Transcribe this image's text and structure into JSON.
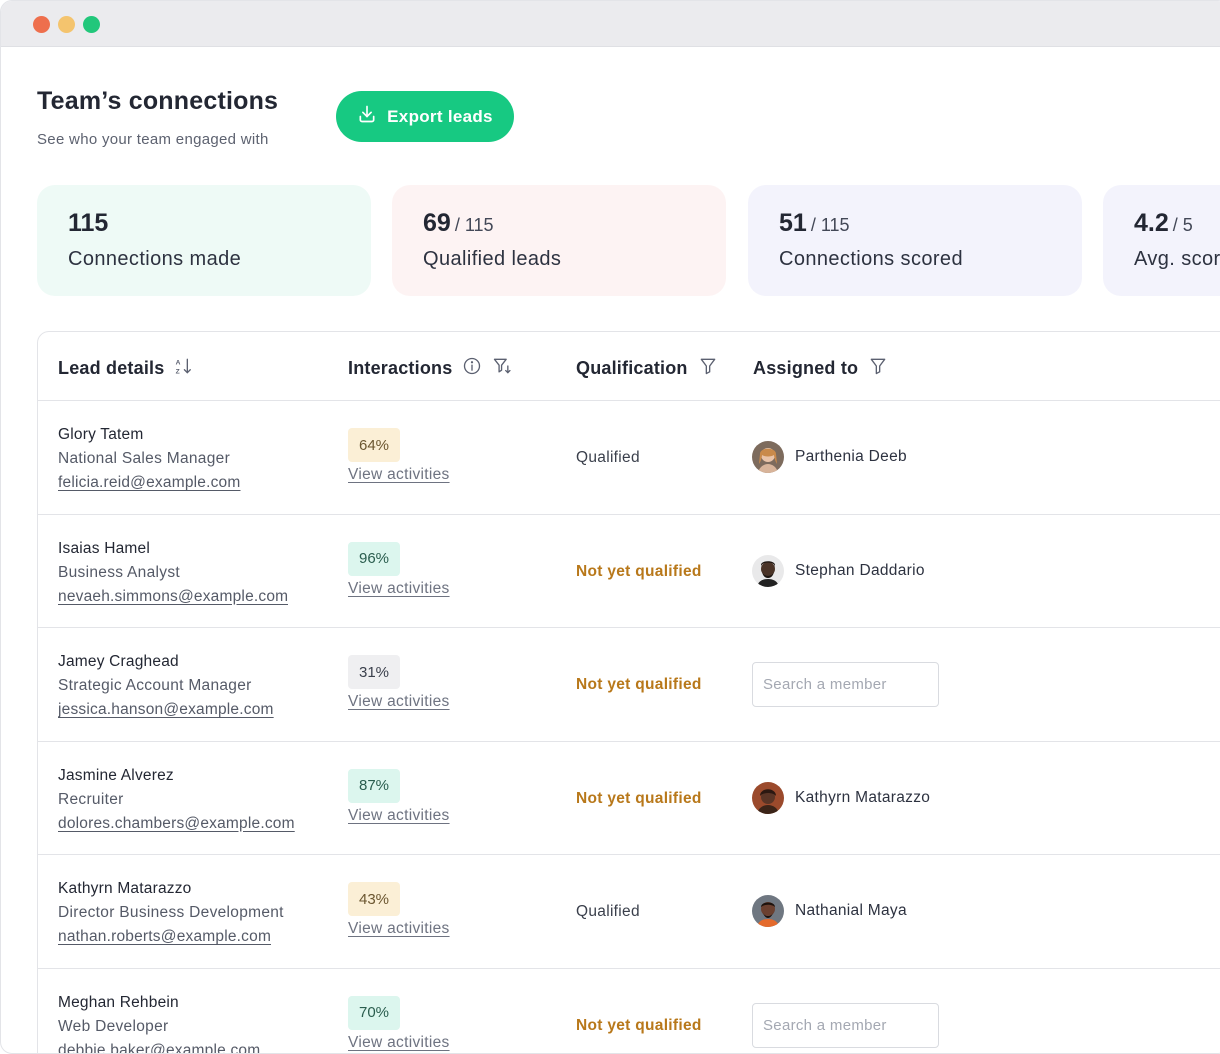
{
  "page": {
    "title": "Team’s connections",
    "subtitle": "See who your team engaged with",
    "export_label": "Export leads"
  },
  "stats": [
    {
      "value": "115",
      "total": "",
      "label": "Connections made"
    },
    {
      "value": "69",
      "total": "/ 115",
      "label": "Qualified leads"
    },
    {
      "value": "51",
      "total": "/ 115",
      "label": "Connections scored"
    },
    {
      "value": "4.2",
      "total": "/ 5",
      "label": "Avg. score"
    }
  ],
  "table": {
    "headers": {
      "lead": "Lead details",
      "interactions": "Interactions",
      "qualification": "Qualification",
      "assigned": "Assigned to"
    },
    "view_label": "View activities",
    "search_placeholder": "Search a member",
    "rows": [
      {
        "name": "Glory Tatem",
        "role": "National Sales Manager",
        "email": "felicia.reid@example.com",
        "interaction": "64%",
        "qualification": "Qualified",
        "assignee": "Parthenia Deeb"
      },
      {
        "name": "Isaias Hamel",
        "role": "Business Analyst",
        "email": "nevaeh.simmons@example.com",
        "interaction": "96%",
        "qualification": "Not yet qualified",
        "assignee": "Stephan Daddario"
      },
      {
        "name": "Jamey Craghead",
        "role": "Strategic Account Manager",
        "email": "jessica.hanson@example.com",
        "interaction": "31%",
        "qualification": "Not yet qualified",
        "assignee": ""
      },
      {
        "name": "Jasmine Alverez",
        "role": "Recruiter",
        "email": "dolores.chambers@example.com",
        "interaction": "87%",
        "qualification": "Not yet qualified",
        "assignee": "Kathyrn Matarazzo"
      },
      {
        "name": "Kathyrn Matarazzo",
        "role": "Director Business Development",
        "email": "nathan.roberts@example.com",
        "interaction": "43%",
        "qualification": "Qualified",
        "assignee": "Nathanial Maya"
      },
      {
        "name": "Meghan Rehbein",
        "role": "Web Developer",
        "email": "debbie.baker@example.com",
        "interaction": "70%",
        "qualification": "Not yet qualified",
        "assignee": ""
      }
    ]
  },
  "colors": {
    "accent": "#17c982",
    "pending": "#b8781a"
  }
}
